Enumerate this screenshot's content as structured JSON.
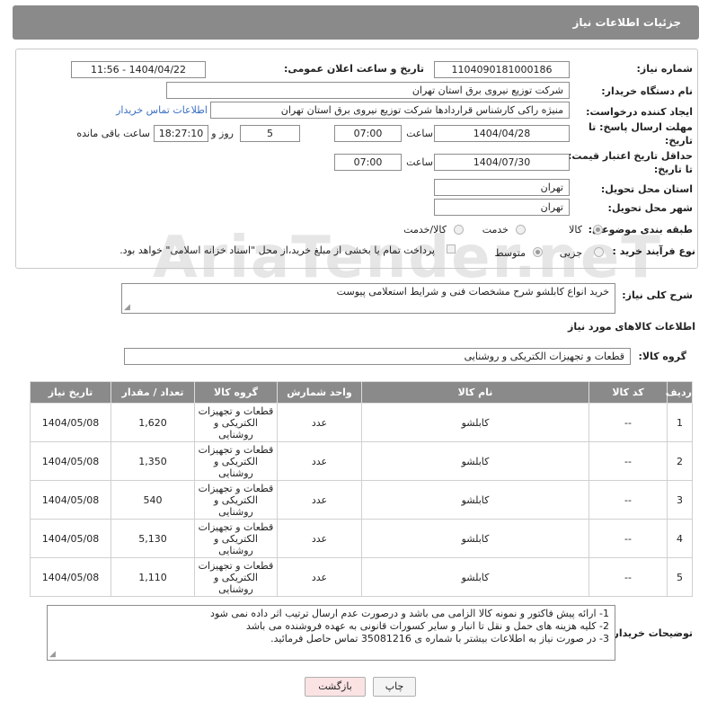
{
  "header": {
    "title": "جزئیات اطلاعات نیاز"
  },
  "watermark": "AriaTender.neT",
  "form": {
    "need_number": {
      "label": "شماره نیاز:",
      "value": "1104090181000186"
    },
    "announce": {
      "label": "تاریخ و ساعت اعلان عمومی:",
      "value": "1404/04/22 - 11:56"
    },
    "buyer": {
      "label": "نام دستگاه خریدار:",
      "value": "شرکت توزیع نیروی برق استان تهران"
    },
    "requester": {
      "label": "ایجاد کننده درخواست:",
      "value": "منیژه راکی کارشناس قراردادها شرکت توزیع نیروی برق استان تهران",
      "contact_link": "اطلاعات تماس خریدار"
    },
    "deadline": {
      "label_line1": "مهلت ارسال پاسخ: تا",
      "label_line2": "تاریخ:",
      "date": "1404/04/28",
      "time_label": "ساعت",
      "time": "07:00",
      "days": "5",
      "days_label": "روز و",
      "remaining": "18:27:10",
      "remaining_label": "ساعت باقی مانده"
    },
    "validity": {
      "label_line1": "حداقل تاریخ اعتبار قیمت:",
      "label_line2": "تا تاریخ:",
      "date": "1404/07/30",
      "time_label": "ساعت",
      "time": "07:00"
    },
    "province": {
      "label": "استان محل تحویل:",
      "value": "تهران"
    },
    "city": {
      "label": "شهر محل تحویل:",
      "value": "تهران"
    },
    "category": {
      "label": "طبقه بندی موضوعی:",
      "options": [
        "کالا",
        "خدمت",
        "کالا/خدمت"
      ],
      "selected": "کالا"
    },
    "purchase": {
      "label": "نوع فرآیند خرید :",
      "options": [
        "جزیی",
        "متوسط"
      ],
      "selected": "متوسط",
      "payment_note": "پرداخت تمام یا بخشی از مبلغ خرید،از محل \"اسناد خزانه اسلامی\" خواهد بود."
    }
  },
  "description": {
    "label": "شرح کلی نیاز:",
    "value": "خرید انواع کابلشو شرح مشخصات فنی و شرایط استعلامی پیوست"
  },
  "goods_section": {
    "title": "اطلاعات کالاهای مورد نیاز",
    "group_label": "گروه کالا:",
    "group_value": "قطعات و تجهیزات الکتریکی و روشنایی"
  },
  "table": {
    "headers": [
      "ردیف",
      "کد کالا",
      "نام کالا",
      "واحد شمارش",
      "گروه کالا",
      "تعداد / مقدار",
      "تاریخ نیاز"
    ],
    "rows": [
      {
        "row": "1",
        "code": "--",
        "name": "کابلشو",
        "unit": "عدد",
        "group": "قطعات و تجهیزات الکتریکی و روشنایی",
        "qty": "1,620",
        "date": "1404/05/08"
      },
      {
        "row": "2",
        "code": "--",
        "name": "کابلشو",
        "unit": "عدد",
        "group": "قطعات و تجهیزات الکتریکی و روشنایی",
        "qty": "1,350",
        "date": "1404/05/08"
      },
      {
        "row": "3",
        "code": "--",
        "name": "کابلشو",
        "unit": "عدد",
        "group": "قطعات و تجهیزات الکتریکی و روشنایی",
        "qty": "540",
        "date": "1404/05/08"
      },
      {
        "row": "4",
        "code": "--",
        "name": "کابلشو",
        "unit": "عدد",
        "group": "قطعات و تجهیزات الکتریکی و روشنایی",
        "qty": "5,130",
        "date": "1404/05/08"
      },
      {
        "row": "5",
        "code": "--",
        "name": "کابلشو",
        "unit": "عدد",
        "group": "قطعات و تجهیزات الکتریکی و روشنایی",
        "qty": "1,110",
        "date": "1404/05/08"
      }
    ]
  },
  "buyer_notes": {
    "label": "توضیحات خریدار:",
    "lines": [
      "1- ارائه پیش فاکتور و نمونه کالا الزامی می باشد و درصورت عدم ارسال ترتیب اثر داده نمی شود",
      "2- کلیه هزینه های حمل و نقل تا انبار و سایر کسورات قانونی به عهده فروشنده می باشد",
      "3- در صورت نیاز به اطلاعات بیشتر با شماره ی 35081216 تماس حاصل فرمائید."
    ]
  },
  "buttons": {
    "print": "چاپ",
    "back": "بازگشت"
  },
  "colors": {
    "header_bg": "#8a8a8a",
    "link": "#3a6fc4",
    "back_button_bg": "#fbe3e3"
  }
}
